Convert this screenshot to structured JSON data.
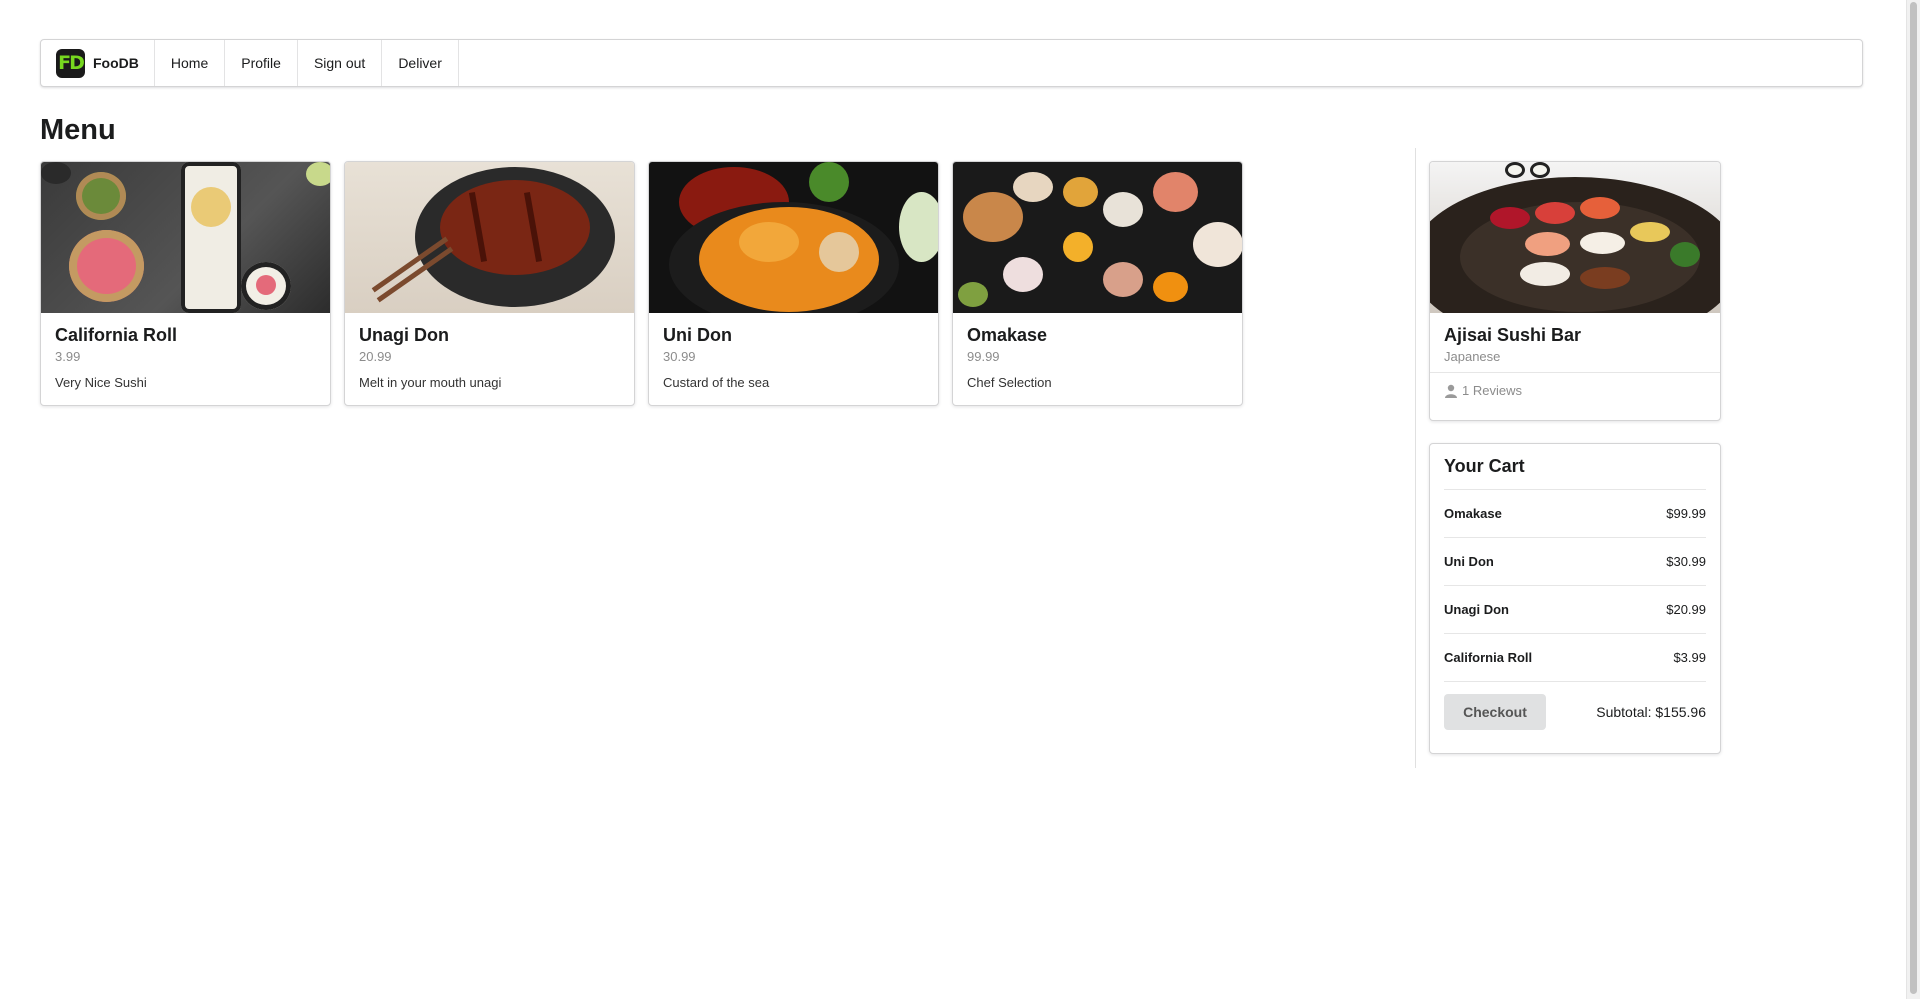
{
  "nav": {
    "brand": "FooDB",
    "logo_text": "FD",
    "items": [
      {
        "label": "Home"
      },
      {
        "label": "Profile"
      },
      {
        "label": "Sign out"
      },
      {
        "label": "Deliver"
      }
    ]
  },
  "page_title": "Menu",
  "menu": [
    {
      "name": "California Roll",
      "price": "3.99",
      "description": "Very Nice Sushi",
      "image": "california-roll-photo"
    },
    {
      "name": "Unagi Don",
      "price": "20.99",
      "description": "Melt in your mouth unagi",
      "image": "unagi-don-photo"
    },
    {
      "name": "Uni Don",
      "price": "30.99",
      "description": "Custard of the sea",
      "image": "uni-don-photo"
    },
    {
      "name": "Omakase",
      "price": "99.99",
      "description": "Chef Selection",
      "image": "omakase-photo"
    }
  ],
  "restaurant": {
    "name": "Ajisai Sushi Bar",
    "cuisine": "Japanese",
    "reviews": "1 Reviews",
    "image": "restaurant-sushi-photo"
  },
  "cart": {
    "title": "Your Cart",
    "items": [
      {
        "name": "Omakase",
        "price": "$99.99"
      },
      {
        "name": "Uni Don",
        "price": "$30.99"
      },
      {
        "name": "Unagi Don",
        "price": "$20.99"
      },
      {
        "name": "California Roll",
        "price": "$3.99"
      }
    ],
    "checkout_label": "Checkout",
    "subtotal": "Subtotal: $155.96"
  },
  "colors": {
    "logo_bg": "#1a1a1a",
    "logo_accent": "#77d81f",
    "button_bg": "#e0e1e2",
    "muted_text": "#8c8c8c"
  }
}
